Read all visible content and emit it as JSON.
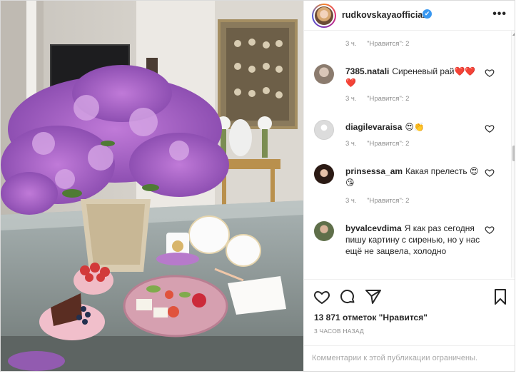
{
  "post": {
    "username": "rudkovskayaofficial",
    "verified_glyph": "✔",
    "more_glyph": "•••"
  },
  "first_meta": {
    "time": "3 ч.",
    "likes": "\"Нравится\": 2"
  },
  "comments": [
    {
      "user": "7385.natali",
      "text": "Сиреневый рай❤️❤️❤️",
      "time": "3 ч.",
      "likes": "\"Нравится\": 2"
    },
    {
      "user": "diagilevaraisa",
      "text": "😍👏",
      "time": "3 ч.",
      "likes": "\"Нравится\": 2"
    },
    {
      "user": "prinsessa_am",
      "text": "Какая прелесть 😍😘",
      "time": "3 ч.",
      "likes": "\"Нравится\": 2"
    },
    {
      "user": "byvalcevdima",
      "text": "Я как раз сегодня пишу картину с сиренью, но у нас ещё не зацвела, холодно"
    }
  ],
  "actions": {
    "icons": [
      "heart-icon",
      "comment-icon",
      "share-icon",
      "bookmark-icon"
    ],
    "likes_count": "13 871 отметок \"Нравится\"",
    "time_ago": "3 ЧАСОВ НАЗАД",
    "comments_restricted": "Комментарии к этой публикации ограничены."
  },
  "colors": {
    "accent_blue": "#3897f0",
    "muted_text": "#8e8e8e",
    "border": "#efefef"
  }
}
